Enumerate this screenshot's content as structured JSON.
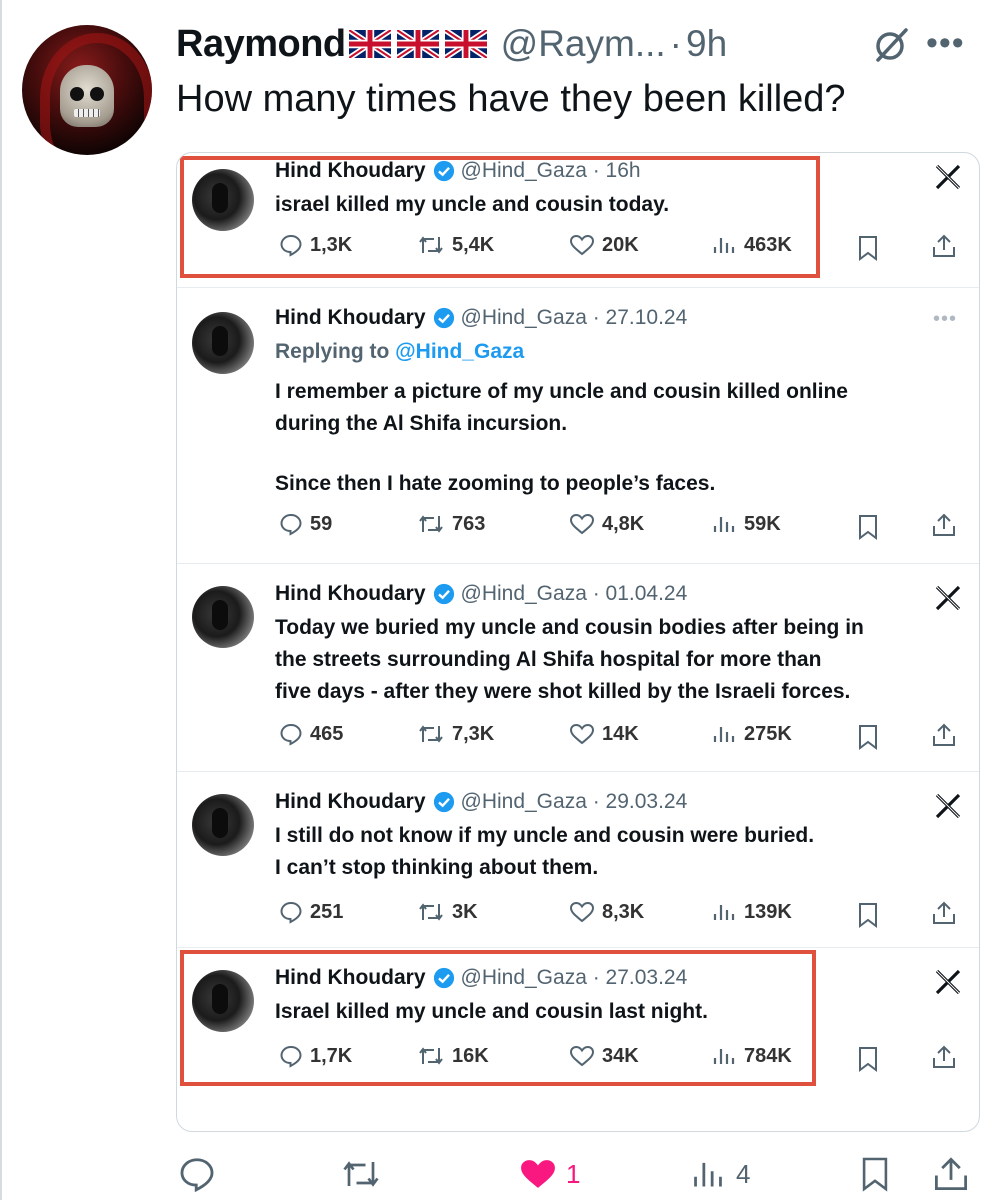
{
  "post": {
    "display_name": "Raymond",
    "handle": "@Raym...",
    "separator": "·",
    "time": "9h",
    "text": "How many times have they been killed?",
    "icons": {
      "avatar": "grim-reaper-avatar",
      "flags": [
        "uk-flag-icon",
        "uk-flag-icon",
        "uk-flag-icon"
      ],
      "grok": "grok-icon",
      "more": "more-icon"
    }
  },
  "embedded_tweets": [
    {
      "name": "Hind Khoudary",
      "handle_date": "@Hind_Gaza · 16h",
      "reply_prefix": "",
      "reply_handle": "",
      "lines": [
        "israel killed my uncle and cousin today."
      ],
      "replies": "1,3K",
      "reposts": "5,4K",
      "likes": "20K",
      "views": "463K",
      "corner": "x-logo",
      "highlighted": true
    },
    {
      "name": "Hind Khoudary",
      "handle_date": "@Hind_Gaza · 27.10.24",
      "reply_prefix": "Replying to ",
      "reply_handle": "@Hind_Gaza",
      "lines": [
        "I remember a picture of my uncle and cousin killed online",
        "during the Al Shifa incursion.",
        "",
        "Since then I hate zooming to people’s faces."
      ],
      "replies": "59",
      "reposts": "763",
      "likes": "4,8K",
      "views": "59K",
      "corner": "more-dots",
      "highlighted": false
    },
    {
      "name": "Hind Khoudary",
      "handle_date": "@Hind_Gaza · 01.04.24",
      "reply_prefix": "",
      "reply_handle": "",
      "lines": [
        "Today we buried my uncle and cousin bodies after being in",
        "the streets surrounding Al Shifa hospital for more than",
        "five days - after they were shot killed by the Israeli forces."
      ],
      "replies": "465",
      "reposts": "7,3K",
      "likes": "14K",
      "views": "275K",
      "corner": "x-logo",
      "highlighted": false
    },
    {
      "name": "Hind Khoudary",
      "handle_date": "@Hind_Gaza · 29.03.24",
      "reply_prefix": "",
      "reply_handle": "",
      "lines": [
        "I still do not know if my uncle and cousin were buried.",
        "I can’t stop thinking about them."
      ],
      "replies": "251",
      "reposts": "3K",
      "likes": "8,3K",
      "views": "139K",
      "corner": "x-logo",
      "highlighted": false
    },
    {
      "name": "Hind Khoudary",
      "handle_date": "@Hind_Gaza · 27.03.24",
      "reply_prefix": "",
      "reply_handle": "",
      "lines": [
        "Israel killed my uncle and cousin last night."
      ],
      "replies": "1,7K",
      "reposts": "16K",
      "likes": "34K",
      "views": "784K",
      "corner": "x-logo",
      "highlighted": true
    }
  ],
  "actions": {
    "reply_count": "",
    "repost_count": "",
    "like_count": "1",
    "view_count": "4",
    "liked": true,
    "colors": {
      "like": "#f91880",
      "icon": "#536471",
      "verified": "#1d9bf0",
      "highlight_box": "#e0513d"
    }
  }
}
